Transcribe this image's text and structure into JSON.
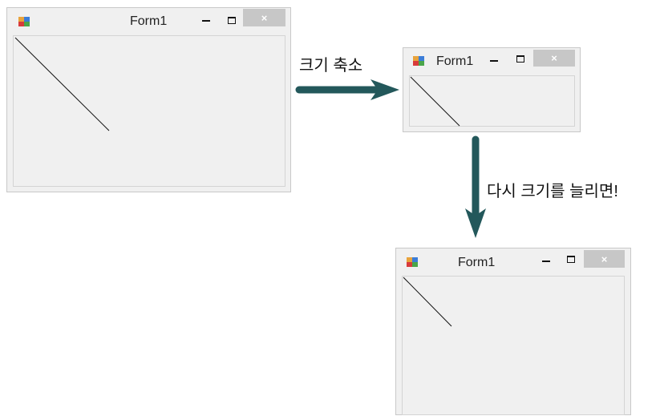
{
  "windows": [
    {
      "title": "Form1",
      "close_glyph": "×",
      "icon": "winforms-app-icon"
    },
    {
      "title": "Form1",
      "close_glyph": "×",
      "icon": "winforms-app-icon"
    },
    {
      "title": "Form1",
      "close_glyph": "×",
      "icon": "winforms-app-icon"
    }
  ],
  "annotations": {
    "shrink": "크기 축소",
    "enlarge": "다시 크기를 늘리면!"
  },
  "colors": {
    "arrow": "#23585b",
    "close_button": "#c7c7c7",
    "window_bg": "#f0f0f0"
  }
}
